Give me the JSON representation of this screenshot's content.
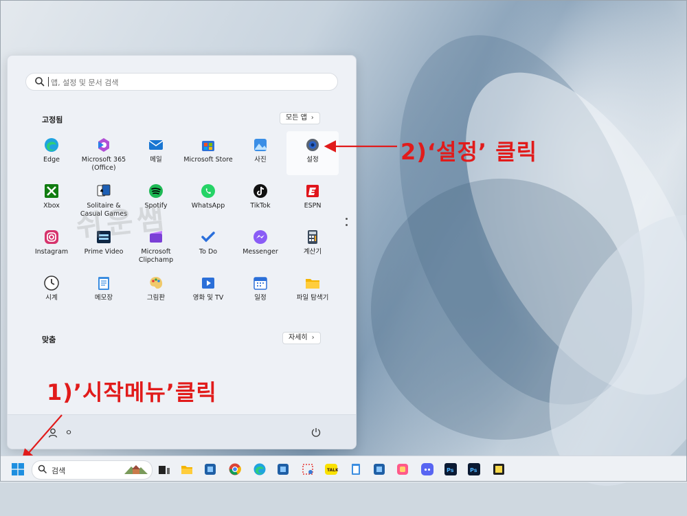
{
  "start_menu": {
    "search_placeholder": "앱, 설정 및 문서 검색",
    "pinned_title": "고정됨",
    "all_apps_label": "모든 앱",
    "recommended_title": "맞춤",
    "more_label": "자세히",
    "user_name": "ㅇ",
    "apps": [
      {
        "label": "Edge",
        "icon": "edge-icon"
      },
      {
        "label": "Microsoft 365\n(Office)",
        "icon": "office-icon"
      },
      {
        "label": "메일",
        "icon": "mail-icon"
      },
      {
        "label": "Microsoft Store",
        "icon": "store-icon"
      },
      {
        "label": "사진",
        "icon": "photos-icon"
      },
      {
        "label": "설정",
        "icon": "gear-icon"
      },
      {
        "label": "Xbox",
        "icon": "xbox-icon"
      },
      {
        "label": "Solitaire &\nCasual Games",
        "icon": "cards-icon"
      },
      {
        "label": "Spotify",
        "icon": "spotify-icon"
      },
      {
        "label": "WhatsApp",
        "icon": "whatsapp-icon"
      },
      {
        "label": "TikTok",
        "icon": "tiktok-icon"
      },
      {
        "label": "ESPN",
        "icon": "espn-icon"
      },
      {
        "label": "Instagram",
        "icon": "instagram-icon"
      },
      {
        "label": "Prime Video",
        "icon": "prime-video-icon"
      },
      {
        "label": "Microsoft\nClipchamp",
        "icon": "clipchamp-icon"
      },
      {
        "label": "To Do",
        "icon": "todo-icon"
      },
      {
        "label": "Messenger",
        "icon": "messenger-icon"
      },
      {
        "label": "계산기",
        "icon": "calculator-icon"
      },
      {
        "label": "시계",
        "icon": "clock-icon"
      },
      {
        "label": "메모장",
        "icon": "notepad-icon"
      },
      {
        "label": "그림판",
        "icon": "paint-icon"
      },
      {
        "label": "영화 및 TV",
        "icon": "movies-icon"
      },
      {
        "label": "일정",
        "icon": "calendar-icon"
      },
      {
        "label": "파일 탐색기",
        "icon": "folder-icon"
      }
    ]
  },
  "annotations": {
    "step1": "1)’시작메뉴’클릭",
    "step2": "2)‘설정’ 클릭",
    "watermark": "쉬운쌤"
  },
  "taskbar": {
    "search_placeholder": "검색",
    "pinned_icons": [
      "task-view-icon",
      "file-explorer-icon",
      "app-icon",
      "chrome-icon",
      "edge-icon",
      "app-icon",
      "snipping-icon",
      "kakaotalk-icon",
      "notepad-icon",
      "app-icon",
      "photos-icon",
      "discord-icon",
      "photoshop-icon",
      "photoshop-icon",
      "sticky-notes-icon"
    ]
  },
  "colors": {
    "annotation": "#e11b1b",
    "menu_bg": "#eef1f6",
    "taskbar_bg": "#eef1f5"
  }
}
